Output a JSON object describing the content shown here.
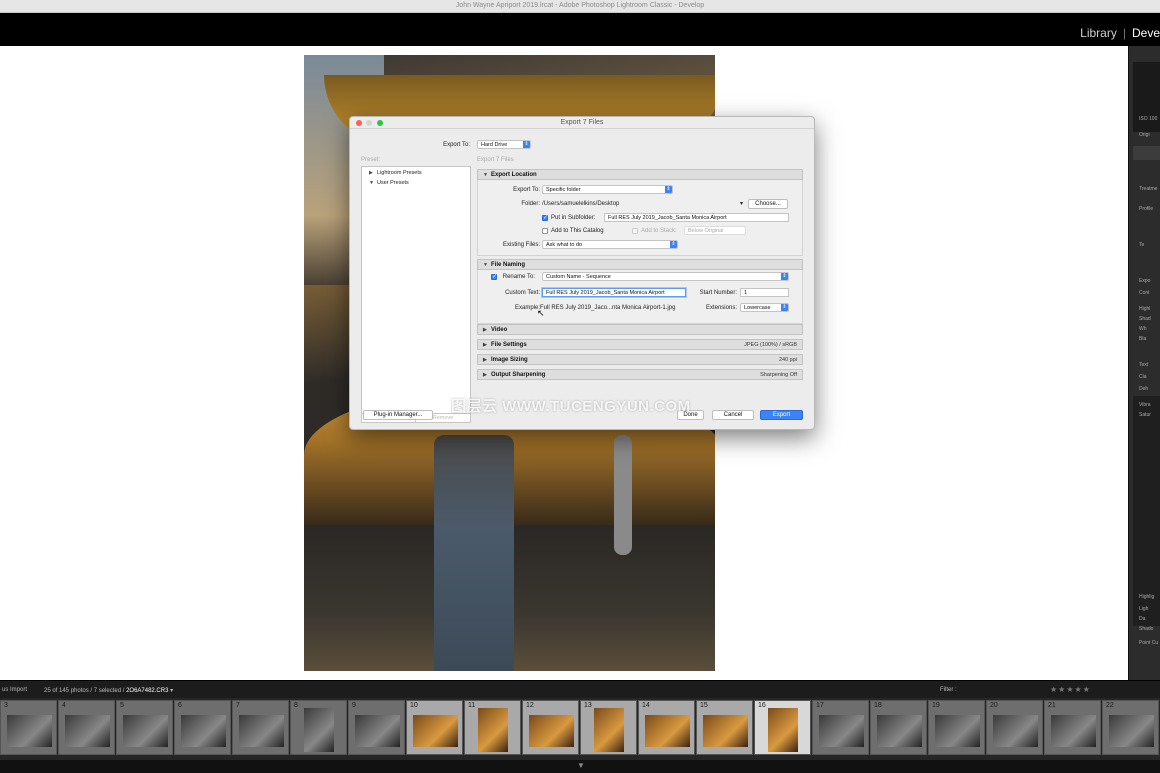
{
  "window": {
    "title": "John Wayne Apriport 2019.lrcat - Adobe Photoshop Lightroom Classic - Develop"
  },
  "modules": {
    "library": "Library",
    "separator": "|",
    "develop": "Deve"
  },
  "right_panel": {
    "labels": [
      "ISO 100",
      "Origi",
      "Treatme",
      "Profile",
      "Te",
      "Expo",
      "Cont",
      "Highl",
      "Shad",
      "Wh",
      "Bla",
      "Text",
      "Cla",
      "Deh",
      "Vibra",
      "Satur",
      "Highlig",
      "Ligh",
      "Da",
      "Shado",
      "Point Cu"
    ]
  },
  "dialog": {
    "title": "Export 7 Files",
    "export_to_label": "Export To:",
    "export_to_value": "Hard Drive",
    "preset_label": "Preset:",
    "files_label": "Export 7 Files",
    "presets": [
      {
        "label": "Lightroom Presets",
        "expanded": false
      },
      {
        "label": "User Presets",
        "expanded": true
      }
    ],
    "add_label": "Add",
    "remove_label": "Remove",
    "plugin_manager_label": "Plug-in Manager...",
    "done_label": "Done",
    "cancel_label": "Cancel",
    "export_label": "Export",
    "export_location": {
      "header": "Export Location",
      "export_to_label": "Export To:",
      "export_to_value": "Specific folder",
      "folder_label": "Folder:",
      "folder_value": "/Users/samuelelkins/Desktop",
      "choose_label": "Choose...",
      "subfolder_label": "Put in Subfolder:",
      "subfolder_checked": true,
      "subfolder_value": "Full RES July 2019_Jacob_Santa Monica Airport",
      "catalog_label": "Add to This Catalog",
      "catalog_checked": false,
      "stack_label": "Add to Stack:",
      "stack_value": "Below Original",
      "existing_label": "Existing Files:",
      "existing_value": "Ask what to do"
    },
    "file_naming": {
      "header": "File Naming",
      "rename_label": "Rename To:",
      "rename_checked": true,
      "rename_value": "Custom Name - Sequence",
      "custom_text_label": "Custom Text:",
      "custom_text_value": "Full RES July 2019_Jacob_Santa Monica Airport",
      "start_number_label": "Start Number:",
      "start_number_value": "1",
      "example_label": "Example:",
      "example_value": "Full RES July 2019_Jaco...nta Monica Airport-1.jpg",
      "extensions_label": "Extensions:",
      "extensions_value": "Lowercase"
    },
    "collapsed_sections": [
      {
        "header": "Video",
        "summary": ""
      },
      {
        "header": "File Settings",
        "summary": "JPEG (100%) / sRGB"
      },
      {
        "header": "Image Sizing",
        "summary": "240 ppi"
      },
      {
        "header": "Output Sharpening",
        "summary": "Sharpening Off"
      }
    ]
  },
  "watermark": "图层云 WWW.TUCENGYUN.COM",
  "filmstrip_bar": {
    "source": "us Import",
    "count_prefix": "25 of 145 photos / 7 selected /",
    "filename": "2O6A7482.CR3",
    "filter_label": "Filter :"
  },
  "filmstrip": {
    "cells": [
      {
        "num": "3",
        "state": "normal",
        "thumb": "plain"
      },
      {
        "num": "4",
        "state": "normal",
        "thumb": "plain"
      },
      {
        "num": "5",
        "state": "normal",
        "thumb": "plain"
      },
      {
        "num": "6",
        "state": "normal",
        "thumb": "plain"
      },
      {
        "num": "7",
        "state": "normal",
        "thumb": "plain"
      },
      {
        "num": "8",
        "state": "normal",
        "thumb": "port"
      },
      {
        "num": "9",
        "state": "normal",
        "thumb": "plain"
      },
      {
        "num": "10",
        "state": "sel",
        "thumb": "warm"
      },
      {
        "num": "11",
        "state": "sel",
        "thumb": "warm-port"
      },
      {
        "num": "12",
        "state": "sel",
        "thumb": "warm"
      },
      {
        "num": "13",
        "state": "sel",
        "thumb": "warm-port"
      },
      {
        "num": "14",
        "state": "sel",
        "thumb": "warm"
      },
      {
        "num": "15",
        "state": "sel",
        "thumb": "warm"
      },
      {
        "num": "16",
        "state": "active",
        "thumb": "warm-port"
      },
      {
        "num": "17",
        "state": "normal",
        "thumb": "plain"
      },
      {
        "num": "18",
        "state": "normal",
        "thumb": "plain"
      },
      {
        "num": "19",
        "state": "normal",
        "thumb": "plain"
      },
      {
        "num": "20",
        "state": "normal",
        "thumb": "plain"
      },
      {
        "num": "21",
        "state": "normal",
        "thumb": "plain"
      },
      {
        "num": "22",
        "state": "normal",
        "thumb": "plain"
      }
    ]
  },
  "colors": {
    "accent": "#3b83f6",
    "panel_dark": "#2c2c2c",
    "filmstrip_bg": "#262626"
  }
}
